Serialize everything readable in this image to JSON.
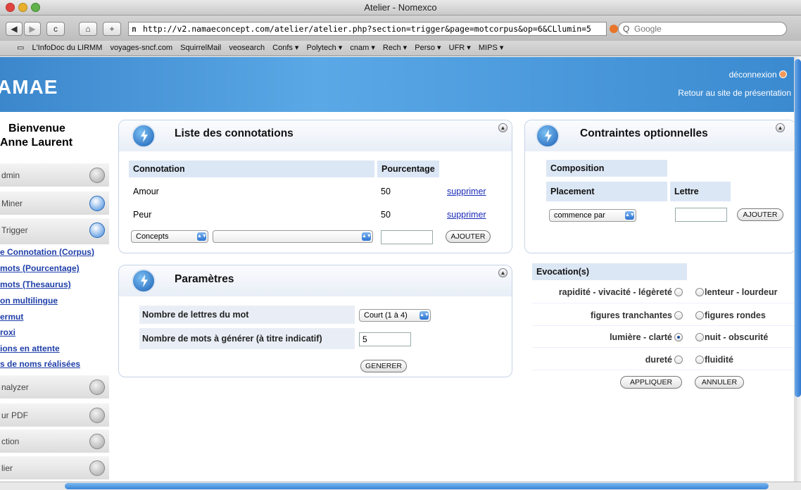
{
  "window": {
    "title": "Atelier - Nomexco"
  },
  "toolbar": {
    "back_label": "◀",
    "forward_label": "▶",
    "reload_label": "c",
    "home_label": "⌂",
    "add_label": "+",
    "url": "http://v2.namaeconcept.com/atelier/atelier.php?section=trigger&page=motcorpus&op=6&CLlumin=5",
    "search_placeholder": "Google"
  },
  "bookmarks": [
    "L'InfoDoc du LIRMM",
    "voyages-sncf.com",
    "SquirrelMail",
    "veosearch",
    "Confs ▾",
    "Polytech ▾",
    "cnam ▾",
    "Rech ▾",
    "Perso ▾",
    "UFR ▾",
    "MIPS ▾"
  ],
  "header": {
    "logo": "AMAE",
    "logout": "déconnexion",
    "retour": "Retour au site de présentation"
  },
  "sidebar": {
    "welcome_line1": "Bienvenue",
    "welcome_line2": "Anne Laurent",
    "sections": [
      {
        "label": "dmin",
        "icon": "gear-icon"
      },
      {
        "label": "Miner",
        "icon": "gear-icon"
      },
      {
        "label": "Trigger",
        "icon": "refresh-icon"
      }
    ],
    "links": [
      "e Connotation (Corpus)",
      "mots (Pourcentage)",
      "mots (Thesaurus)",
      "on multilingue",
      "ermut",
      "roxi",
      "ions en attente",
      "s de noms réalisées"
    ],
    "bottom_sections": [
      {
        "label": "nalyzer"
      },
      {
        "label": "ur PDF"
      },
      {
        "label": "ction"
      },
      {
        "label": "lier"
      }
    ]
  },
  "connotations": {
    "title": "Liste des connotations",
    "col_connotation": "Connotation",
    "col_pourcentage": "Pourcentage",
    "rows": [
      {
        "connotation": "Amour",
        "pourcentage": "50",
        "action": "supprimer"
      },
      {
        "connotation": "Peur",
        "pourcentage": "50",
        "action": "supprimer"
      }
    ],
    "select1": "Concepts",
    "select2": "",
    "add_button": "AJOUTER"
  },
  "parametres": {
    "title": "Paramètres",
    "label_lettres": "Nombre de lettres du mot",
    "select_lettres": "Court (1 à 4)",
    "label_mots": "Nombre de mots à générer (à titre indicatif)",
    "input_mots": "5",
    "generer_button": "GENERER"
  },
  "contraintes": {
    "title": "Contraintes optionnelles",
    "composition": "Composition",
    "placement": "Placement",
    "lettre": "Lettre",
    "select_placement": "commence par",
    "add_button": "AJOUTER",
    "evocation_header": "Evocation(s)",
    "evocations": [
      {
        "left": "rapidité - vivacité - légèreté",
        "right": "lenteur - lourdeur",
        "selected": "none"
      },
      {
        "left": "figures tranchantes",
        "right": "figures rondes",
        "selected": "none"
      },
      {
        "left": "lumière - clarté",
        "right": "nuit - obscurité",
        "selected": "left"
      },
      {
        "left": "dureté",
        "right": "fluidité",
        "selected": "none"
      }
    ],
    "apply_button": "APPLIQUER",
    "cancel_button": "ANNULER"
  }
}
